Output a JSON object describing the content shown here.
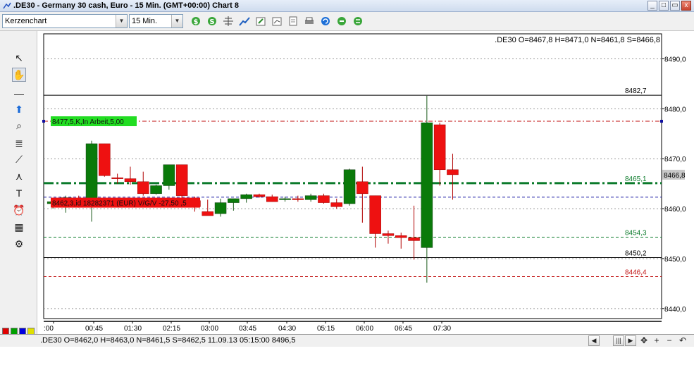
{
  "window": {
    "title": ".DE30 - Germany 30 cash, Euro - 15 Min. (GMT+00:00)   Chart 8",
    "controls": [
      "_",
      "□",
      "▭",
      "x"
    ]
  },
  "toolbar": {
    "chart_type": "Kerzenchart",
    "interval": "15 Min.",
    "icons": [
      "buy-icon",
      "sell-icon",
      "crosshair-icon",
      "indicator-icon",
      "edit-icon",
      "zoom-chart-icon",
      "document-icon",
      "print-icon",
      "refresh-icon",
      "settings-icon",
      "settings2-icon"
    ]
  },
  "left_tools": [
    {
      "name": "cursor-arrow-icon",
      "glyph": "↖"
    },
    {
      "name": "hand-tool-icon",
      "glyph": "✋"
    },
    {
      "name": "horizontal-line-icon",
      "glyph": "—"
    },
    {
      "name": "arrow-up-icon",
      "glyph": "⬆"
    },
    {
      "name": "zoom-icon",
      "glyph": "⌕"
    },
    {
      "name": "fibonacci-icon",
      "glyph": "≣"
    },
    {
      "name": "fan-lines-icon",
      "glyph": "⟋"
    },
    {
      "name": "pitchfork-icon",
      "glyph": "⋏"
    },
    {
      "name": "text-tool-icon",
      "glyph": "T"
    },
    {
      "name": "alarm-clock-icon",
      "glyph": "⏰"
    },
    {
      "name": "calculator-icon",
      "glyph": "▦"
    },
    {
      "name": "properties-icon",
      "glyph": "⚙"
    }
  ],
  "palette_colors": [
    "#e00000",
    "#00a000",
    "#0000e0",
    "#e0e000",
    "#ffffff",
    "#800000",
    "#404040",
    "#000000"
  ],
  "colors": {
    "bull": "#0a7a0a",
    "bear": "#ee1111",
    "grid": "#9a9a9a",
    "green_line": "#0a7a2a",
    "red_line": "#c01010",
    "blue_line": "#1010a0"
  },
  "chart_data": {
    "type": "candlestick",
    "symbol": ".DE30",
    "info_label": ".DE30 O=8467,8 H=8471,0 N=8461,8 S=8466,8",
    "ylim": [
      8438,
      8495
    ],
    "y_ticks": [
      8440,
      8450,
      8460,
      8470,
      8480,
      8490
    ],
    "y_tick_labels": [
      "8440,0",
      "8450,0",
      "8460,0",
      "8470,0",
      "8480,0",
      "8490,0"
    ],
    "x_tick_labels": [
      ":00",
      "00:45",
      "01:30",
      "02:15",
      "03:00",
      "03:45",
      "04:30",
      "05:15",
      "06:00",
      "06:45",
      "07:30"
    ],
    "current_price_label": "8466,8",
    "current_price": 8466.8,
    "candles": [
      {
        "o": 8461.0,
        "h": 8461.8,
        "l": 8460.0,
        "c": 8461.4
      },
      {
        "o": 8461.4,
        "h": 8462.6,
        "l": 8459.2,
        "c": 8462.2
      },
      {
        "o": 8461.8,
        "h": 8462.6,
        "l": 8460.2,
        "c": 8461.0
      },
      {
        "o": 8462.0,
        "h": 8473.6,
        "l": 8457.4,
        "c": 8473.0
      },
      {
        "o": 8473.0,
        "h": 8473.0,
        "l": 8466.4,
        "c": 8466.6
      },
      {
        "o": 8466.2,
        "h": 8467.0,
        "l": 8465.0,
        "c": 8466.0
      },
      {
        "o": 8466.0,
        "h": 8468.4,
        "l": 8464.8,
        "c": 8465.4
      },
      {
        "o": 8465.4,
        "h": 8467.4,
        "l": 8462.6,
        "c": 8463.0
      },
      {
        "o": 8463.0,
        "h": 8464.8,
        "l": 8462.8,
        "c": 8464.6
      },
      {
        "o": 8464.6,
        "h": 8468.8,
        "l": 8463.8,
        "c": 8468.8
      },
      {
        "o": 8468.8,
        "h": 8468.8,
        "l": 8461.6,
        "c": 8462.6
      },
      {
        "o": 8461.6,
        "h": 8462.4,
        "l": 8459.4,
        "c": 8460.4
      },
      {
        "o": 8459.4,
        "h": 8461.8,
        "l": 8458.6,
        "c": 8458.6
      },
      {
        "o": 8459.0,
        "h": 8462.0,
        "l": 8458.4,
        "c": 8461.2
      },
      {
        "o": 8461.2,
        "h": 8462.0,
        "l": 8459.6,
        "c": 8462.0
      },
      {
        "o": 8462.0,
        "h": 8463.0,
        "l": 8461.2,
        "c": 8462.8
      },
      {
        "o": 8462.8,
        "h": 8463.0,
        "l": 8462.2,
        "c": 8462.4
      },
      {
        "o": 8462.4,
        "h": 8462.8,
        "l": 8461.4,
        "c": 8461.4
      },
      {
        "o": 8461.8,
        "h": 8462.4,
        "l": 8461.4,
        "c": 8462.0
      },
      {
        "o": 8462.0,
        "h": 8462.6,
        "l": 8461.4,
        "c": 8461.8
      },
      {
        "o": 8461.8,
        "h": 8463.0,
        "l": 8461.4,
        "c": 8462.6
      },
      {
        "o": 8462.6,
        "h": 8463.0,
        "l": 8461.0,
        "c": 8461.2
      },
      {
        "o": 8461.2,
        "h": 8462.0,
        "l": 8460.0,
        "c": 8460.4
      },
      {
        "o": 8461.0,
        "h": 8468.0,
        "l": 8460.6,
        "c": 8467.8
      },
      {
        "o": 8465.4,
        "h": 8468.4,
        "l": 8457.2,
        "c": 8463.0
      },
      {
        "o": 8462.6,
        "h": 8462.6,
        "l": 8452.2,
        "c": 8455.0
      },
      {
        "o": 8455.0,
        "h": 8455.6,
        "l": 8453.0,
        "c": 8454.6
      },
      {
        "o": 8454.6,
        "h": 8455.2,
        "l": 8452.0,
        "c": 8454.2
      },
      {
        "o": 8454.2,
        "h": 8460.6,
        "l": 8449.8,
        "c": 8453.6
      },
      {
        "o": 8452.2,
        "h": 8482.6,
        "l": 8445.2,
        "c": 8477.2
      },
      {
        "o": 8476.8,
        "h": 8477.2,
        "l": 8464.6,
        "c": 8467.8
      },
      {
        "o": 8467.8,
        "h": 8471.0,
        "l": 8461.8,
        "c": 8466.8
      }
    ],
    "levels": [
      {
        "value": 8482.7,
        "label": "8482,7",
        "style": "solid",
        "color": "#000000"
      },
      {
        "value": 8477.5,
        "label": "",
        "style": "dashdot",
        "color": "#c01010"
      },
      {
        "value": 8465.1,
        "label": "8465,1",
        "style": "dashdot-bold",
        "color": "#0a7a2a"
      },
      {
        "value": 8462.3,
        "label": "",
        "style": "dashed",
        "color": "#1010a0"
      },
      {
        "value": 8454.3,
        "label": "8454,3",
        "style": "dashed",
        "color": "#0a7a2a"
      },
      {
        "value": 8450.2,
        "label": "8450,2",
        "style": "solid",
        "color": "#000000"
      },
      {
        "value": 8446.4,
        "label": "8446,4",
        "style": "dashed",
        "color": "#c01010"
      }
    ],
    "order_labels": [
      {
        "text": "8477,5,K,In Arbeit,5,00",
        "price": 8477.5,
        "bg": "#22dd22"
      },
      {
        "text": "8462,3,id 18282371 (EUR) V/G/V -27,50 ,5",
        "price": 8461.2,
        "bg": "#ee1111"
      }
    ]
  },
  "status": {
    "text": ".DE30 O=8462,0 H=8463,0 N=8461,5 S=8462,5    11.09.13 05:15:00 8496,5"
  },
  "status_buttons": [
    "◀",
    "|||",
    "▶",
    "✥",
    "+",
    "−",
    "↶"
  ]
}
